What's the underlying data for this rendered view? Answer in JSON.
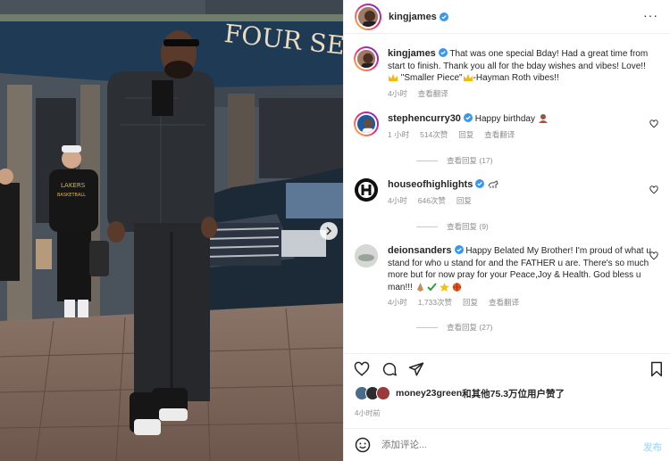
{
  "post": {
    "author": "kingjames",
    "header_more": "···",
    "photo": {
      "hotel_sign": "FOUR SEAS",
      "shirt_text_1": "LAKERS",
      "shirt_text_2": "BASKETBALL"
    }
  },
  "comments": [
    {
      "username": "kingjames",
      "text_1": "That was one special Bday! Had a great time from start to finish. Thank you all for the bday wishes and vibes! Love!!",
      "quote": "\"Smaller Piece\"",
      "text_2": "-Hayman Roth vibes!!",
      "time": "4小时",
      "see_translation": "查看翻译"
    },
    {
      "username": "stephencurry30",
      "text": "Happy birthday",
      "time": "1 小时",
      "likes": "514次赞",
      "reply": "回复",
      "see_translation": "查看翻译",
      "view_replies": "查看回复 (17)"
    },
    {
      "username": "houseofhighlights",
      "time": "4小时",
      "likes": "646次赞",
      "reply": "回复",
      "view_replies": "查看回复 (9)"
    },
    {
      "username": "deionsanders",
      "text": "Happy Belated My Brother! I'm proud of what u stand for who u stand for and the FATHER u are. There's so much more but for now pray for your Peace,Joy & Health. God bless u man!!!",
      "time": "4小时",
      "likes": "1,733次赞",
      "reply": "回复",
      "see_translation": "查看翻译",
      "view_replies": "查看回复 (27)"
    }
  ],
  "likes_line": {
    "first": "money23green",
    "rest": "和其他75.3万位用户赞了"
  },
  "post_time": "4小时前",
  "add_comment": {
    "placeholder": "添加评论...",
    "post_label": "发布"
  },
  "colors": {
    "verified": "#3897f0",
    "post_disabled": "#b2dffc",
    "muted": "#8e8e8e"
  },
  "icons": [
    "heart-icon",
    "comment-icon",
    "share-icon",
    "bookmark-icon",
    "emoji-icon",
    "more-icon",
    "verified-icon",
    "next-arrow-icon"
  ]
}
